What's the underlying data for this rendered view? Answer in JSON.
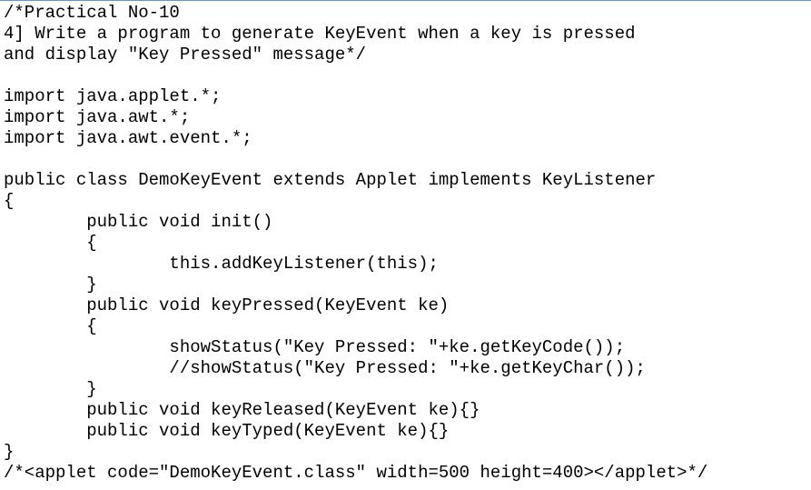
{
  "document": {
    "lines": [
      "/*Practical No-10",
      "4] Write a program to generate KeyEvent when a key is pressed",
      "and display \"Key Pressed\" message*/",
      "",
      "import java.applet.*;",
      "import java.awt.*;",
      "import java.awt.event.*;",
      "",
      "public class DemoKeyEvent extends Applet implements KeyListener",
      "{",
      "        public void init()",
      "        {",
      "                this.addKeyListener(this);",
      "        }",
      "        public void keyPressed(KeyEvent ke)",
      "        {",
      "                showStatus(\"Key Pressed: \"+ke.getKeyCode());",
      "                //showStatus(\"Key Pressed: \"+ke.getKeyChar());",
      "        }",
      "        public void keyReleased(KeyEvent ke){}",
      "        public void keyTyped(KeyEvent ke){}",
      "}",
      "/*<applet code=\"DemoKeyEvent.class\" width=500 height=400></applet>*/"
    ]
  },
  "colors": {
    "text": "#000000",
    "background": "#ffffff",
    "top_border": "#5b9bd5"
  }
}
